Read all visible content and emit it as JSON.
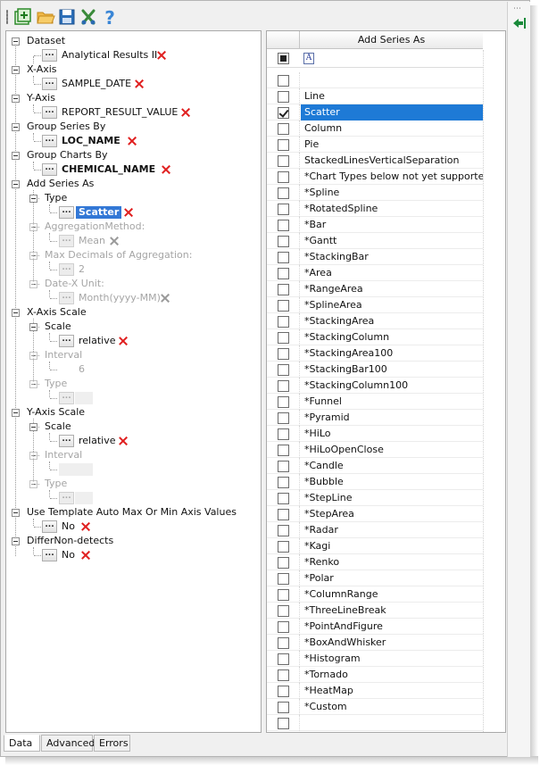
{
  "toolbar": {
    "buttons": [
      {
        "name": "add-chart-icon"
      },
      {
        "name": "open-folder-icon"
      },
      {
        "name": "save-disk-icon"
      },
      {
        "name": "tools-icon"
      },
      {
        "name": "help-icon"
      }
    ]
  },
  "right_panel": {
    "dots": "⋯",
    "arrow_icon": "collapse-arrow-icon"
  },
  "tree": {
    "dataset_label": "Dataset",
    "dataset_value": "Analytical Results II",
    "xaxis_label": "X-Axis",
    "xaxis_value": "SAMPLE_DATE",
    "yaxis_label": "Y-Axis",
    "yaxis_value": "REPORT_RESULT_VALUE",
    "group_series_label": "Group Series By",
    "group_series_value": "LOC_NAME",
    "group_charts_label": "Group Charts By",
    "group_charts_value": "CHEMICAL_NAME",
    "add_series_label": "Add Series As",
    "type_label": "Type",
    "type_value": "Scatter",
    "agg_method_label": "AggregationMethod:",
    "agg_method_value": "Mean",
    "max_decimals_label": "Max Decimals of Aggregation:",
    "max_decimals_value": "2",
    "date_unit_label": "Date-X Unit:",
    "date_unit_value": "Month(yyyy-MM)",
    "xaxis_scale_label": "X-Axis Scale",
    "x_scale_label": "Scale",
    "x_scale_value": "relative",
    "x_interval_label": "Interval",
    "x_interval_value": "6",
    "x_type_label": "Type",
    "yaxis_scale_label": "Y-Axis Scale",
    "y_scale_label": "Scale",
    "y_scale_value": "relative",
    "y_interval_label": "Interval",
    "y_type_label": "Type",
    "template_label": "Use Template Auto Max Or Min Axis Values",
    "template_value": "No",
    "differ_label": "DifferNon-detects",
    "differ_value": "No",
    "dots": "..."
  },
  "grid": {
    "header": "Add Series As",
    "filter_icon_text": "A",
    "rows": [
      {
        "text": "",
        "checked": false,
        "selected": false
      },
      {
        "text": "Line",
        "checked": false,
        "selected": false
      },
      {
        "text": "Scatter",
        "checked": true,
        "selected": true
      },
      {
        "text": "Column",
        "checked": false,
        "selected": false
      },
      {
        "text": "Pie",
        "checked": false,
        "selected": false
      },
      {
        "text": "StackedLinesVerticalSeparation",
        "checked": false,
        "selected": false
      },
      {
        "text": "*Chart Types below not yet supported.",
        "checked": false,
        "selected": false
      },
      {
        "text": "*Spline",
        "checked": false,
        "selected": false
      },
      {
        "text": "*RotatedSpline",
        "checked": false,
        "selected": false
      },
      {
        "text": "*Bar",
        "checked": false,
        "selected": false
      },
      {
        "text": "*Gantt",
        "checked": false,
        "selected": false
      },
      {
        "text": "*StackingBar",
        "checked": false,
        "selected": false
      },
      {
        "text": "*Area",
        "checked": false,
        "selected": false
      },
      {
        "text": "*RangeArea",
        "checked": false,
        "selected": false
      },
      {
        "text": "*SplineArea",
        "checked": false,
        "selected": false
      },
      {
        "text": "*StackingArea",
        "checked": false,
        "selected": false
      },
      {
        "text": "*StackingColumn",
        "checked": false,
        "selected": false
      },
      {
        "text": "*StackingArea100",
        "checked": false,
        "selected": false
      },
      {
        "text": "*StackingBar100",
        "checked": false,
        "selected": false
      },
      {
        "text": "*StackingColumn100",
        "checked": false,
        "selected": false
      },
      {
        "text": "*Funnel",
        "checked": false,
        "selected": false
      },
      {
        "text": "*Pyramid",
        "checked": false,
        "selected": false
      },
      {
        "text": "*HiLo",
        "checked": false,
        "selected": false
      },
      {
        "text": "*HiLoOpenClose",
        "checked": false,
        "selected": false
      },
      {
        "text": "*Candle",
        "checked": false,
        "selected": false
      },
      {
        "text": "*Bubble",
        "checked": false,
        "selected": false
      },
      {
        "text": "*StepLine",
        "checked": false,
        "selected": false
      },
      {
        "text": "*StepArea",
        "checked": false,
        "selected": false
      },
      {
        "text": "*Radar",
        "checked": false,
        "selected": false
      },
      {
        "text": "*Kagi",
        "checked": false,
        "selected": false
      },
      {
        "text": "*Renko",
        "checked": false,
        "selected": false
      },
      {
        "text": "*Polar",
        "checked": false,
        "selected": false
      },
      {
        "text": "*ColumnRange",
        "checked": false,
        "selected": false
      },
      {
        "text": "*ThreeLineBreak",
        "checked": false,
        "selected": false
      },
      {
        "text": "*PointAndFigure",
        "checked": false,
        "selected": false
      },
      {
        "text": "*BoxAndWhisker",
        "checked": false,
        "selected": false
      },
      {
        "text": "*Histogram",
        "checked": false,
        "selected": false
      },
      {
        "text": "*Tornado",
        "checked": false,
        "selected": false
      },
      {
        "text": "*HeatMap",
        "checked": false,
        "selected": false
      },
      {
        "text": "*Custom",
        "checked": false,
        "selected": false
      },
      {
        "text": "",
        "checked": false,
        "selected": false
      }
    ]
  },
  "tabs": [
    {
      "label": "Data",
      "active": true
    },
    {
      "label": "Advanced",
      "active": false
    },
    {
      "label": "Errors",
      "active": false
    }
  ],
  "colors": {
    "selection": "#1e7ad6",
    "remove_x": "#e02020"
  }
}
